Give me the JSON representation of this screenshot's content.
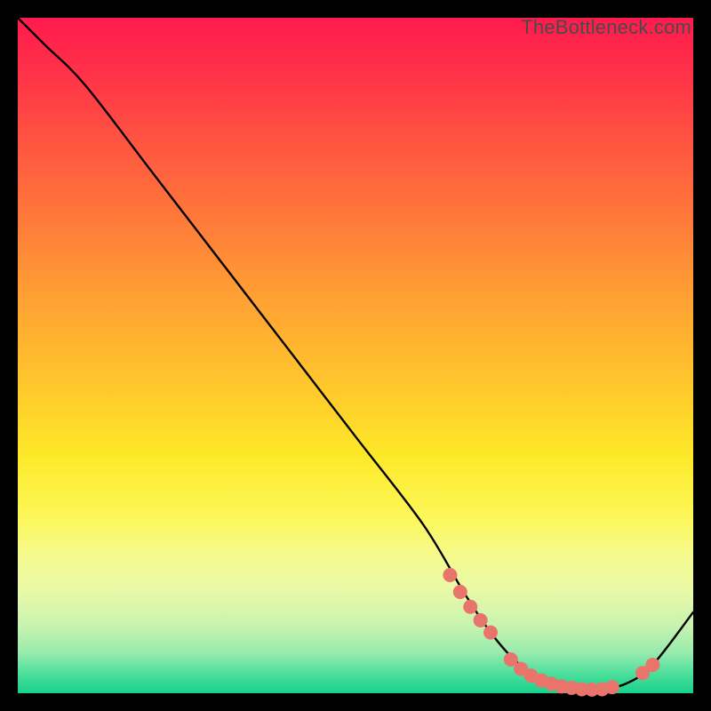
{
  "watermark": "TheBottleneck.com",
  "colors": {
    "curve": "#000000",
    "marker_fill": "#e9746b",
    "marker_stroke": "#d55a52"
  },
  "chart_data": {
    "type": "line",
    "title": "",
    "xlabel": "",
    "ylabel": "",
    "xlim": [
      0,
      100
    ],
    "ylim": [
      0,
      100
    ],
    "grid": false,
    "series": [
      {
        "name": "bottleneck-curve",
        "x": [
          0,
          4,
          10,
          20,
          30,
          40,
          50,
          60,
          66,
          70,
          74,
          78,
          82,
          86,
          90,
          94,
          100
        ],
        "y": [
          100,
          96,
          90,
          77,
          64,
          51,
          38,
          25,
          15,
          9,
          4.5,
          1.8,
          0.7,
          0.6,
          1.4,
          4.2,
          12
        ]
      }
    ],
    "markers": [
      {
        "x": 64.0,
        "y": 17.5
      },
      {
        "x": 65.5,
        "y": 15.0
      },
      {
        "x": 67.0,
        "y": 12.8
      },
      {
        "x": 68.5,
        "y": 10.8
      },
      {
        "x": 70.0,
        "y": 9.0
      },
      {
        "x": 73.0,
        "y": 5.0
      },
      {
        "x": 74.5,
        "y": 3.6
      },
      {
        "x": 76.0,
        "y": 2.6
      },
      {
        "x": 77.5,
        "y": 1.9
      },
      {
        "x": 79.0,
        "y": 1.4
      },
      {
        "x": 80.5,
        "y": 1.0
      },
      {
        "x": 82.0,
        "y": 0.8
      },
      {
        "x": 83.5,
        "y": 0.6
      },
      {
        "x": 85.0,
        "y": 0.55
      },
      {
        "x": 86.5,
        "y": 0.6
      },
      {
        "x": 88.0,
        "y": 0.9
      },
      {
        "x": 92.5,
        "y": 3.0
      },
      {
        "x": 94.0,
        "y": 4.2
      }
    ]
  }
}
